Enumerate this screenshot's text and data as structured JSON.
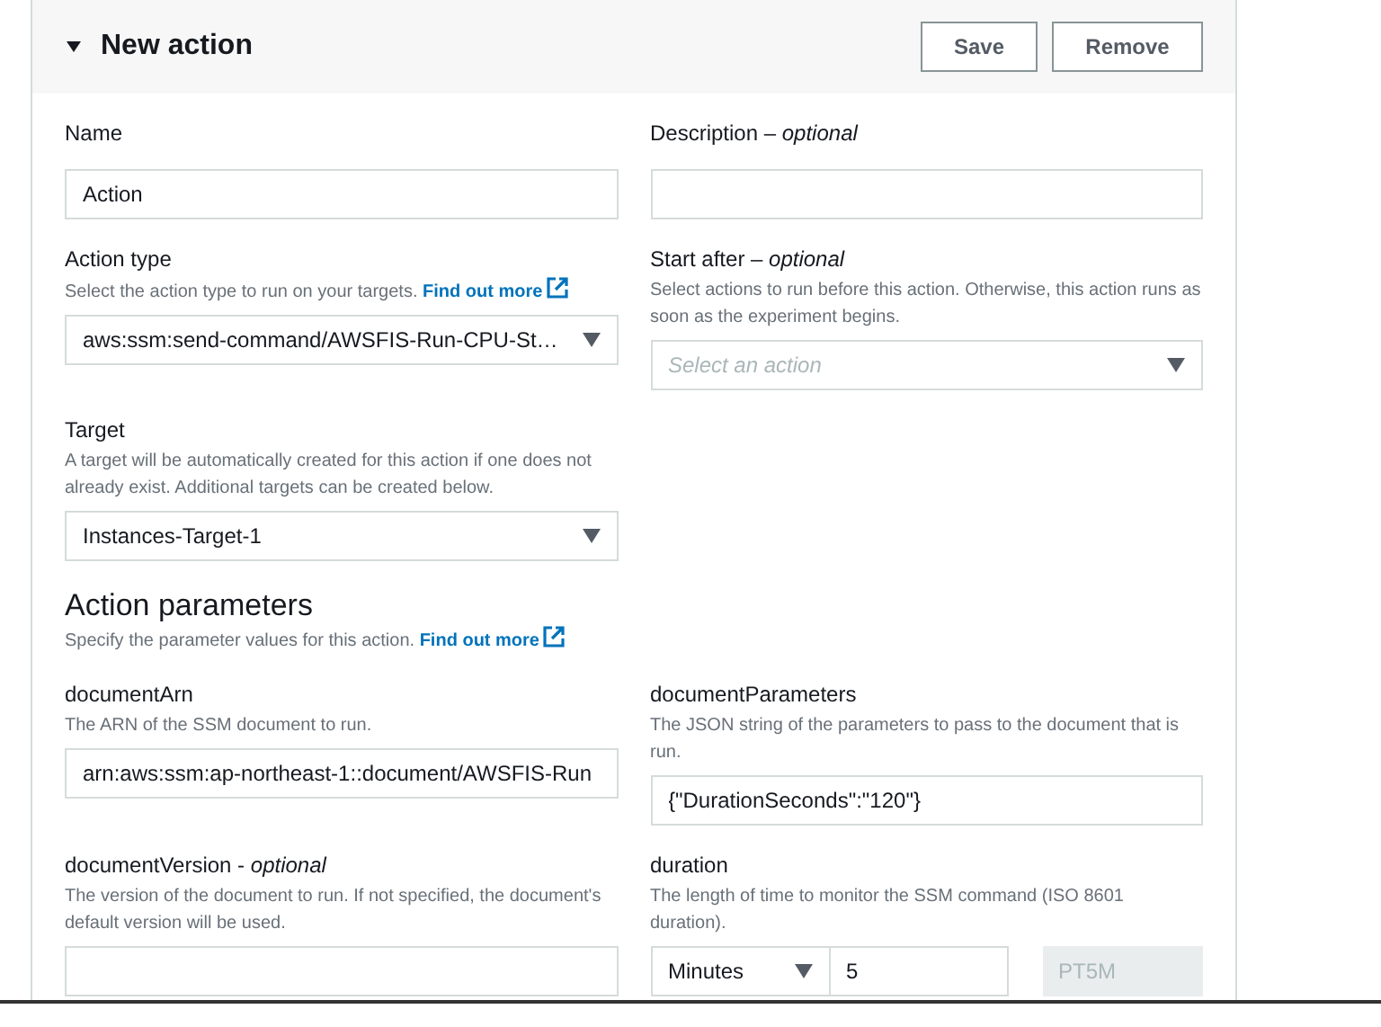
{
  "header": {
    "title": "New action",
    "expanded": true
  },
  "buttons": [
    "Save",
    "Remove"
  ],
  "rows": [
    {
      "cells": [
        {
          "kind": "input",
          "label": "Name",
          "value": "Action"
        },
        {
          "kind": "input",
          "label": "Description – *optional*"
        }
      ]
    },
    {
      "cells": [
        {
          "kind": "select",
          "label": "Action type",
          "hint": "Select the action type to run on your targets.",
          "link": "Find out more",
          "value": "aws:ssm:send-command/AWSFIS-Run-CPU-St…"
        },
        {
          "kind": "select",
          "label": "Start after – *optional*",
          "hint": "Select actions to run before this action. Otherwise, this action runs as soon as the experiment begins.",
          "placeholder": "Select an action"
        }
      ]
    },
    {
      "cells": [
        {
          "kind": "select",
          "label": "Target",
          "hint": "A target will be automatically created for this action if one does not already exist. Additional targets can be created below.",
          "value": "Instances-Target-1"
        }
      ]
    },
    {
      "section": {
        "title": "Action parameters",
        "hint": "Specify the parameter values for this action.",
        "link": "Find out more"
      }
    },
    {
      "cells": [
        {
          "kind": "input",
          "label": "documentArn",
          "hint": "The ARN of the SSM document to run.",
          "value": "arn:aws:ssm:ap-northeast-1::document/AWSFIS-Run"
        },
        {
          "kind": "input",
          "label": "documentParameters",
          "hint": "The JSON string of the parameters to pass to the document that is run.",
          "value": "{\"DurationSeconds\":\"120\"}"
        }
      ]
    },
    {
      "cells": [
        {
          "kind": "input",
          "label": "documentVersion - *optional*",
          "hint": "The version of the document to run. If not specified, the document's default version will be used."
        },
        {
          "kind": "duration",
          "label": "duration",
          "hint": "The length of time to monitor the SSM command (ISO 8601 duration).",
          "unit": "Minutes",
          "value": "5",
          "result": "PT5M"
        }
      ]
    }
  ]
}
